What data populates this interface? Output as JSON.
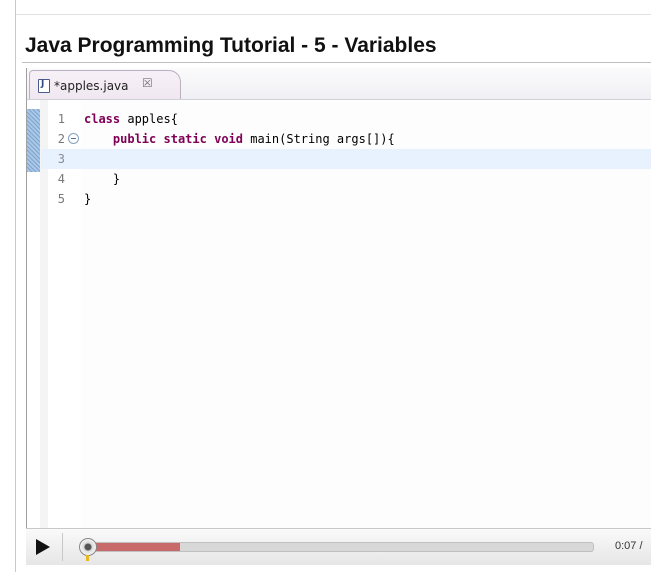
{
  "page": {
    "title": "Java Programming Tutorial - 5 - Variables"
  },
  "editor": {
    "tab": {
      "label": "*apples.java",
      "close_glyph": "☒",
      "icon": "java-file-icon",
      "icon_glyph": "J"
    },
    "lines": [
      {
        "number": "1",
        "tokens": [
          {
            "text": "class",
            "kw": true
          },
          {
            "text": " apples{"
          }
        ]
      },
      {
        "number": "2",
        "folding": true,
        "tokens": [
          {
            "text": "    "
          },
          {
            "text": "public",
            "kw": true
          },
          {
            "text": " "
          },
          {
            "text": "static",
            "kw": true
          },
          {
            "text": " "
          },
          {
            "text": "void",
            "kw": true
          },
          {
            "text": " main(String args[]){"
          }
        ]
      },
      {
        "number": "3",
        "active": true,
        "tokens": []
      },
      {
        "number": "4",
        "tokens": [
          {
            "text": "    }"
          }
        ]
      },
      {
        "number": "5",
        "tokens": [
          {
            "text": "}"
          }
        ]
      }
    ],
    "colors": {
      "keyword": "#7f0055",
      "current_line": "#e8f2fe",
      "gutter_marker": "#a9c7e6"
    }
  },
  "player": {
    "time": "0:07 /",
    "progress_fraction": 0.19,
    "icons": {
      "play": "play-icon",
      "scrubber": "scrubber-knob"
    }
  }
}
